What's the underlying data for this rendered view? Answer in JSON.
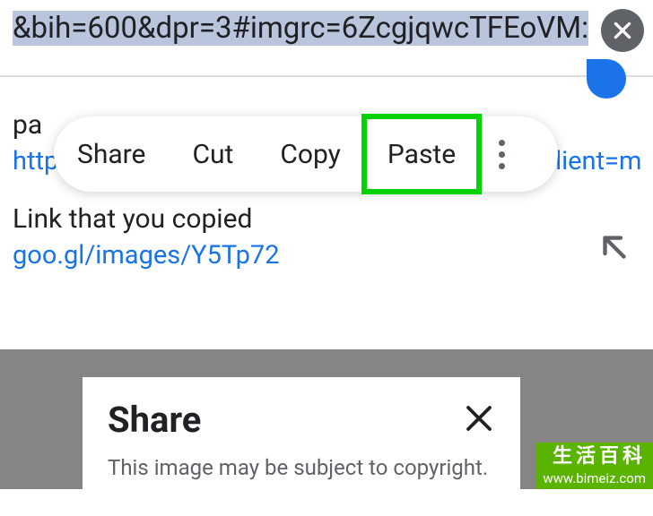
{
  "address_bar": {
    "url_fragment": "&bih=600&dpr=3#imgrc=6ZcgjqwcTFEoVM:"
  },
  "context_menu": {
    "share": "Share",
    "cut": "Cut",
    "copy": "Copy",
    "paste": "Paste"
  },
  "suggestions": {
    "first": {
      "title_prefix": "pa",
      "url": "https://www.google.com/search?q=pancake&client=ms"
    },
    "copied": {
      "title": "Link that you copied",
      "url": "goo.gl/images/Y5Tp72"
    }
  },
  "share_sheet": {
    "title": "Share",
    "subtitle": "This image may be subject to copyright."
  },
  "watermark": {
    "line1": "生活百科",
    "line2": "www.bimeiz.com"
  }
}
